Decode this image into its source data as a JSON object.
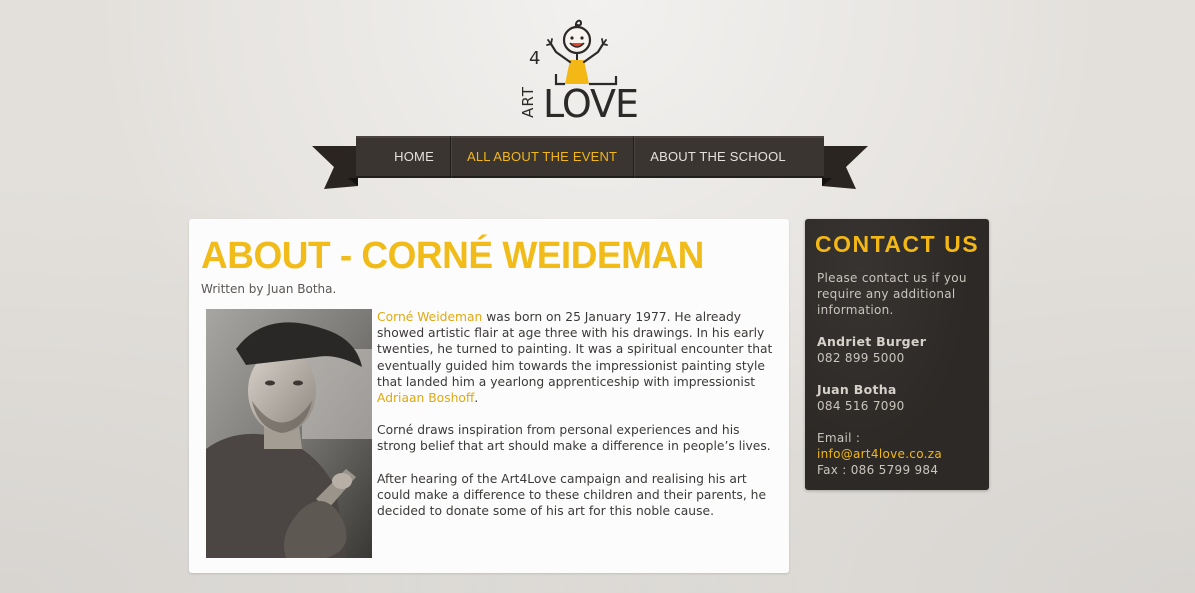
{
  "logo": {
    "alt": "Art4Love",
    "art": "ART",
    "four": "4",
    "love": "LOVE"
  },
  "nav": {
    "items": [
      {
        "label": "HOME",
        "active": false
      },
      {
        "label": "ALL ABOUT THE EVENT",
        "active": true
      },
      {
        "label": "ABOUT THE SCHOOL",
        "active": false
      }
    ]
  },
  "article": {
    "title": "ABOUT - CORNÉ WEIDEMAN",
    "byline": "Written by Juan Botha.",
    "p1_link": "Corné Weideman",
    "p1_text": " was born on 25 January 1977. He already showed artistic flair at age three with his drawings.  In his early twenties, he turned to painting.  It was a spiritual encounter that eventually guided him towards the impressionist painting style that landed him a yearlong apprenticeship with impressionist ",
    "p1_link2": "Adriaan Boshoff",
    "p1_end": ".",
    "p2": "Corné draws inspiration from personal experiences and his strong belief that art should make a difference in people’s lives.",
    "p3": "After hearing of the Art4Love campaign and realising his art could make a difference to these children and their parents, he decided to donate some of his art for this noble cause."
  },
  "sidebar": {
    "title": "CONTACT US",
    "intro": "Please contact us if you require any additional information.",
    "contacts": [
      {
        "name": "Andriet Burger",
        "phone": "082 899 5000"
      },
      {
        "name": "Juan Botha",
        "phone": "084 516 7090"
      }
    ],
    "email_label": "Email :",
    "email": "info@art4love.co.za",
    "fax": "Fax : 086 5799 984"
  },
  "colors": {
    "accent": "#f3b716",
    "ribbon": "#3a3430",
    "sidebar_bg": "#2d2926",
    "page_bg": "#e3e0dc"
  }
}
